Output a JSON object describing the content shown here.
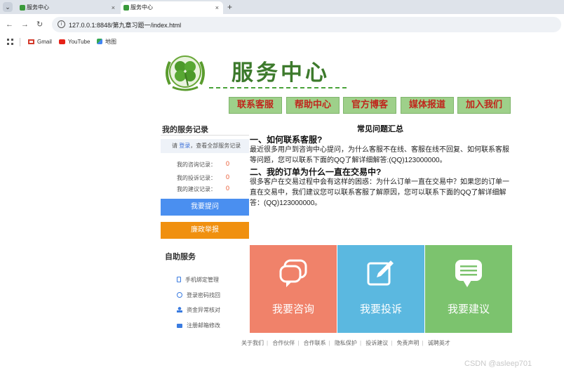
{
  "browser": {
    "tabs": [
      {
        "title": "服务中心"
      },
      {
        "title": "服务中心"
      }
    ],
    "new_tab": "+",
    "tab_close": "×",
    "nav": {
      "back": "←",
      "forward": "→",
      "reload": "↻"
    },
    "url": "127.0.0.1:8848/第九章习题一/index.html",
    "bookmarks": [
      {
        "label": "Gmail",
        "color": "#d33b2c"
      },
      {
        "label": "YouTube",
        "color": "#e62117"
      },
      {
        "label": "地图",
        "color": "#34a853"
      }
    ]
  },
  "header": {
    "title": "服务中心",
    "nav": [
      "联系客服",
      "帮助中心",
      "官方博客",
      "媒体报道",
      "加入我们"
    ]
  },
  "sidebar": {
    "title": "我的服务记录",
    "login_prefix": "请 ",
    "login_link": "登录",
    "login_suffix": "，查看全部服务记录",
    "records": [
      {
        "label": "我的咨询记录：",
        "value": "0"
      },
      {
        "label": "我的投诉记录：",
        "value": "0"
      },
      {
        "label": "我的建议记录：",
        "value": "0"
      }
    ],
    "ask_button": "我要提问",
    "report_button": "廉政举报",
    "self_service_title": "自助服务",
    "self_service": [
      {
        "label": "手机绑定管理",
        "icon": "phone-icon"
      },
      {
        "label": "登录密码找回",
        "icon": "search-icon"
      },
      {
        "label": "资金异常核对",
        "icon": "user-icon"
      },
      {
        "label": "注册邮箱修改",
        "icon": "mail-icon"
      }
    ]
  },
  "faq": {
    "title": "常见问题汇总",
    "items": [
      {
        "q": "一、如何联系客服?",
        "a": "最近很多用户到咨询中心提问，为什么客服不在线、客服在线不回复、如何联系客服等问题，您可以联系下面的QQ了解详细解答:(QQ)123000000。"
      },
      {
        "q": "二、我的订单为什么一直在交易中?",
        "a": "很多客户在交易过程中会有这样的困惑：为什么订单一直在交易中？如果您的订单一直在交易中，我们建议您可以联系客服了解原因，您可以联系下面的QQ了解详细解答：(QQ)123000000。"
      }
    ]
  },
  "tiles": [
    {
      "label": "我要咨询",
      "color": "#f0826a",
      "icon": "chat-icon"
    },
    {
      "label": "我要投诉",
      "color": "#5bb8e0",
      "icon": "edit-icon"
    },
    {
      "label": "我要建议",
      "color": "#7cc36e",
      "icon": "message-icon"
    }
  ],
  "footer": [
    "关于我们",
    "合作伙伴",
    "合作联系",
    "隐私保护",
    "投诉建议",
    "免责声明",
    "诚聘英才"
  ],
  "watermark": "CSDN @asleep701"
}
